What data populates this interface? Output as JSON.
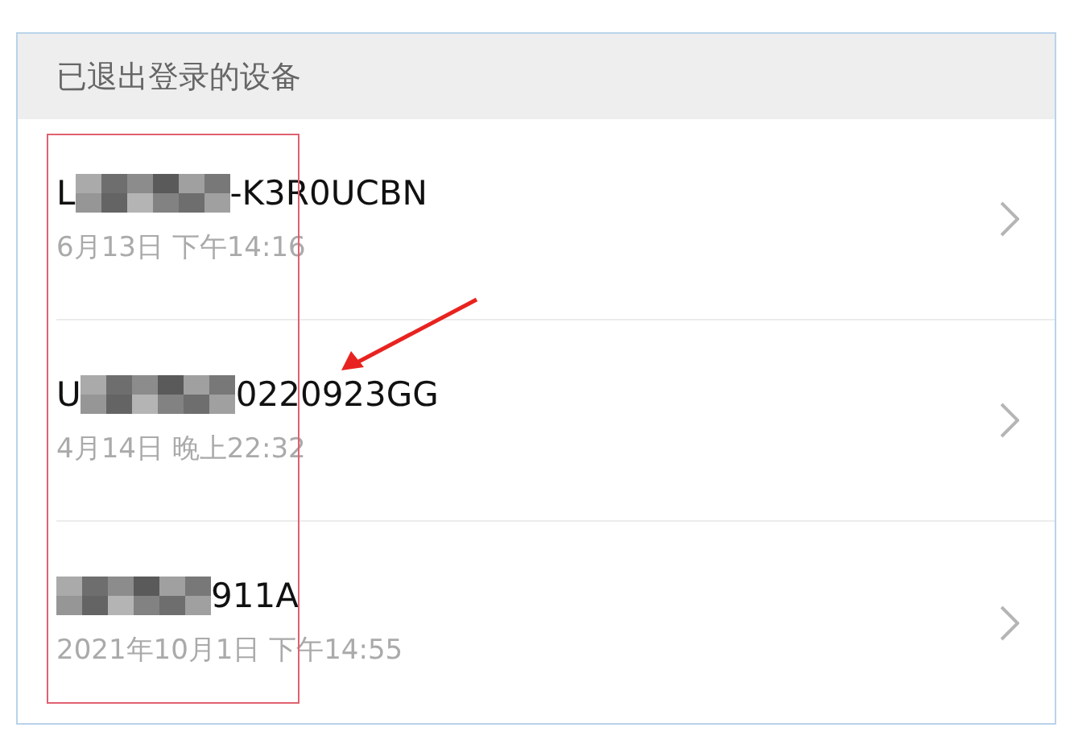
{
  "section": {
    "title": "已退出登录的设备"
  },
  "devices": [
    {
      "name_start": "L",
      "name_end": "-K3R0UCBN",
      "time": "6月13日 下午14:16"
    },
    {
      "name_start": "U",
      "name_end": "0220923GG",
      "time": "4月14日 晚上22:32"
    },
    {
      "name_end": "911A",
      "time": "2021年10月1日 下午14:55"
    }
  ]
}
